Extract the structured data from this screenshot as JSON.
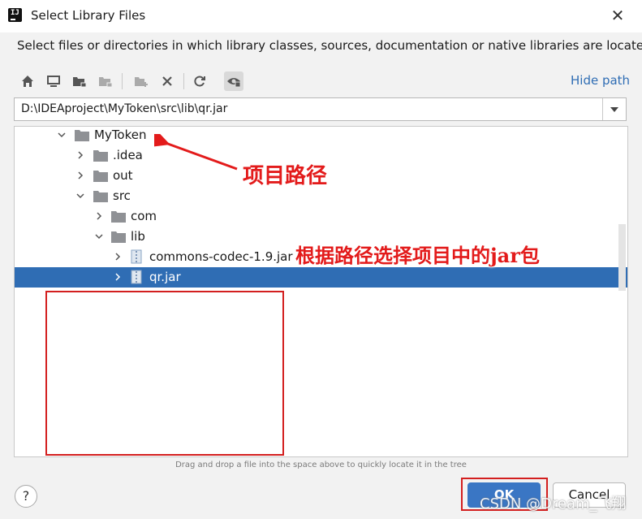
{
  "window": {
    "title": "Select Library Files",
    "close_glyph": "✕"
  },
  "description": "Select files or directories in which library classes, sources, documentation or native libraries are located",
  "toolbar": {
    "buttons": [
      "home-icon",
      "desktop-icon",
      "project-folder-icon",
      "module-folder-icon",
      "new-folder-icon",
      "delete-icon",
      "refresh-icon",
      "show-hidden-icon"
    ],
    "hide_path_label": "Hide path"
  },
  "path": {
    "value": "D:\\IDEAproject\\MyToken\\src\\lib\\qr.jar"
  },
  "tree": {
    "rows": [
      {
        "label": "MyToken",
        "expanded": true,
        "kind": "folder"
      },
      {
        "label": ".idea",
        "expanded": false,
        "kind": "folder"
      },
      {
        "label": "out",
        "expanded": false,
        "kind": "folder"
      },
      {
        "label": "src",
        "expanded": true,
        "kind": "folder"
      },
      {
        "label": "com",
        "expanded": false,
        "kind": "folder"
      },
      {
        "label": "lib",
        "expanded": true,
        "kind": "folder"
      },
      {
        "label": "commons-codec-1.9.jar",
        "expanded": false,
        "kind": "jar"
      },
      {
        "label": "qr.jar",
        "expanded": false,
        "kind": "jar",
        "selected": true
      }
    ]
  },
  "hint": "Drag and drop a file into the space above to quickly locate it in the tree",
  "buttons": {
    "help": "?",
    "ok": "OK",
    "cancel": "Cancel"
  },
  "annotations": {
    "project_path": "项目路径",
    "select_jar": "根据路径选择项目中的jar包"
  },
  "watermark": "CSDN @Dream_飞翔",
  "colors": {
    "accent": "#2f6db4",
    "annotation": "#e31b1b",
    "selection": "#2f6db4"
  }
}
